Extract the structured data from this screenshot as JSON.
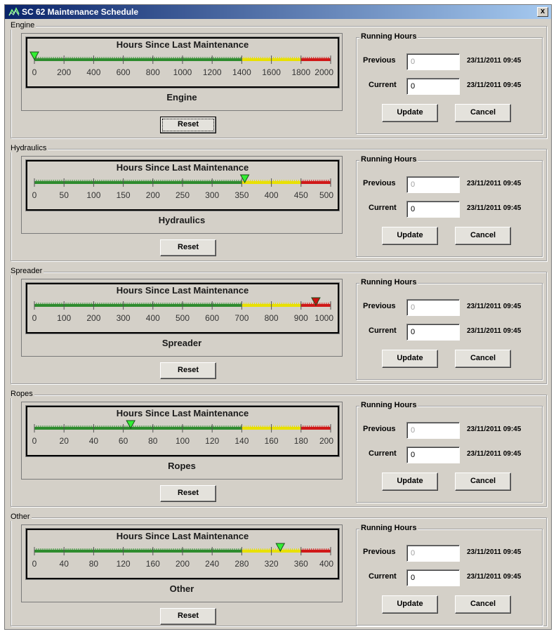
{
  "window": {
    "title": "SC 62 Maintenance Schedule",
    "close_label": "x"
  },
  "colors": {
    "green": "#2e8b2e",
    "yellow": "#e8e000",
    "red": "#d01818",
    "pointer_green": "#33ee33",
    "pointer_red": "#cc1010"
  },
  "gauge_title": "Hours Since Last Maintenance",
  "running_hours": {
    "legend": "Running Hours",
    "previous_label": "Previous",
    "current_label": "Current",
    "update_label": "Update",
    "cancel_label": "Cancel"
  },
  "reset_label": "Reset",
  "sections": [
    {
      "legend": "Engine",
      "gauge_name": "Engine",
      "ticks": [
        "0",
        "200",
        "400",
        "600",
        "800",
        "1000",
        "1200",
        "1400",
        "1600",
        "1800",
        "2000"
      ],
      "max": 2000,
      "yellow_start": 1400,
      "red_start": 1800,
      "pointer_value": 0,
      "pointer_color": "green",
      "previous_value": "0",
      "current_value": "0",
      "previous_date": "23/11/2011 09:45",
      "current_date": "23/11/2011 09:45"
    },
    {
      "legend": "Hydraulics",
      "gauge_name": "Hydraulics",
      "ticks": [
        "0",
        "50",
        "100",
        "150",
        "200",
        "250",
        "300",
        "350",
        "400",
        "450",
        "500"
      ],
      "max": 500,
      "yellow_start": 350,
      "red_start": 450,
      "pointer_value": 355,
      "pointer_color": "green",
      "previous_value": "0",
      "current_value": "0",
      "previous_date": "23/11/2011 09:45",
      "current_date": "23/11/2011 09:45"
    },
    {
      "legend": "Spreader",
      "gauge_name": "Spreader",
      "ticks": [
        "0",
        "100",
        "200",
        "300",
        "400",
        "500",
        "600",
        "700",
        "800",
        "900",
        "1000"
      ],
      "max": 1000,
      "yellow_start": 700,
      "red_start": 900,
      "pointer_value": 950,
      "pointer_color": "red",
      "previous_value": "0",
      "current_value": "0",
      "previous_date": "23/11/2011 09:45",
      "current_date": "23/11/2011 09:45"
    },
    {
      "legend": "Ropes",
      "gauge_name": "Ropes",
      "ticks": [
        "0",
        "20",
        "40",
        "60",
        "80",
        "100",
        "120",
        "140",
        "160",
        "180",
        "200"
      ],
      "max": 200,
      "yellow_start": 140,
      "red_start": 180,
      "pointer_value": 65,
      "pointer_color": "green",
      "previous_value": "0",
      "current_value": "0",
      "previous_date": "23/11/2011 09:45",
      "current_date": "23/11/2011 09:45"
    },
    {
      "legend": "Other",
      "gauge_name": "Other",
      "ticks": [
        "0",
        "40",
        "80",
        "120",
        "160",
        "200",
        "240",
        "280",
        "320",
        "360",
        "400"
      ],
      "max": 400,
      "yellow_start": 280,
      "red_start": 360,
      "pointer_value": 332,
      "pointer_color": "green",
      "previous_value": "0",
      "current_value": "0",
      "previous_date": "23/11/2011 09:45",
      "current_date": "23/11/2011 09:45"
    }
  ]
}
